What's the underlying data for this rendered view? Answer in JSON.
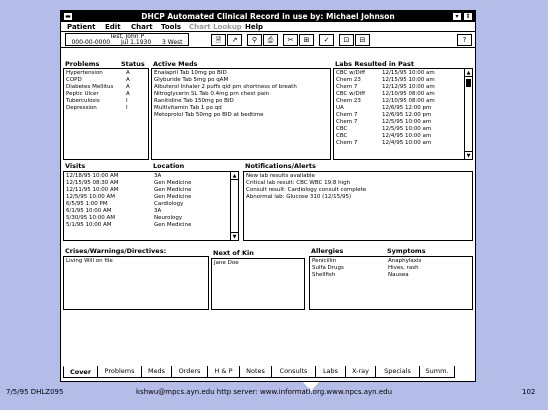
{
  "window": {
    "title": "DHCP Automated Clinical Record in use by: Michael Johnson",
    "control_icon": "▬",
    "minimize_icon": "▾",
    "restore_icon": "⇕"
  },
  "menu": [
    "Patient",
    "Edit",
    "Chart",
    "Tools",
    "Chart Lookup",
    "Help"
  ],
  "patient": {
    "name": "Test, John P",
    "ssn": "000-00-0000",
    "dob": "Jul 1,1930",
    "ward": "3 West"
  },
  "toolbar_icons": [
    "🗎",
    "↗",
    "⚲",
    "⎙",
    "✂",
    "⊞",
    "✓",
    "⊡",
    "⊟",
    "?"
  ],
  "problems": {
    "label": "Problems",
    "status_label": "Status",
    "rows": [
      [
        "Hypertension",
        "A"
      ],
      [
        "COPD",
        "A"
      ],
      [
        "Diabetes Mellitus",
        "A"
      ],
      [
        "Peptic Ulcer",
        "A"
      ],
      [
        "Tuberculosis",
        "I"
      ],
      [
        "Depression",
        "I"
      ]
    ]
  },
  "active_meds": {
    "label": "Active Meds",
    "rows": [
      "Enalapril Tab 10mg po BID",
      "Glyburide Tab 5mg po qAM",
      "Albuterol Inhaler 2 puffs qid prn shortness of breath",
      "Nitroglycerin SL Tab 0.4mg prn chest pain",
      "Ranitidine Tab 150mg po BID",
      "Multivitamin Tab 1 po qd",
      "Metoprolol Tab 50mg po BID at bedtime"
    ]
  },
  "labs": {
    "label": "Labs Resulted in Past",
    "rows": [
      [
        "CBC w/Diff",
        "12/15/95 10:00 am"
      ],
      [
        "Chem 23",
        "12/15/95 10:00 am"
      ],
      [
        "Chem 7",
        "12/12/95 10:00 am"
      ],
      [
        "CBC w/Diff",
        "12/10/95 08:00 am"
      ],
      [
        "Chem 23",
        "12/10/95 08:00 am"
      ],
      [
        "UA",
        "12/6/95 12:00 pm"
      ],
      [
        "Chem 7",
        "12/6/95 12:00 pm"
      ],
      [
        "Chem 7",
        "12/5/95 10:00 am"
      ],
      [
        "CBC",
        "12/5/95 10:00 am"
      ],
      [
        "CBC",
        "12/4/95 10:00 am"
      ],
      [
        "Chem 7",
        "12/4/95 10:00 am"
      ]
    ]
  },
  "visits": {
    "label": "Visits",
    "location_label": "Location",
    "rows": [
      [
        "12/18/95 10:00 AM",
        "3A"
      ],
      [
        "12/15/95 08:30 AM",
        "Gen Medicine"
      ],
      [
        "12/11/95 10:00 AM",
        "Gen Medicine"
      ],
      [
        "12/5/95 10:00 AM",
        "Gen Medicine"
      ],
      [
        "6/5/95 1:00 PM",
        "Cardiology"
      ],
      [
        "6/1/95 10:00 AM",
        "3A"
      ],
      [
        "5/30/95 10:00 AM",
        "Neurology"
      ],
      [
        "5/1/95 10:00 AM",
        "Gen Medicine"
      ]
    ]
  },
  "notifications": {
    "label": "Notifications/Alerts",
    "rows": [
      "New lab results available",
      "Critical lab result: CBC WBC 19.8 high",
      "Consult result: Cardiology consult complete",
      "Abnormal lab: Glucose 310 (12/15/95)"
    ]
  },
  "crises": {
    "label": "Crises/Warnings/Directives:",
    "rows": [
      "Living Will on file"
    ]
  },
  "next_of_kin": {
    "label": "Next of Kin",
    "rows": [
      "Jane Doe"
    ]
  },
  "allergies": {
    "label": "Allergies",
    "symptoms_label": "Symptoms",
    "rows": [
      [
        "Penicillin",
        "Anaphylaxis"
      ],
      [
        "Sulfa Drugs",
        "Hives, rash"
      ],
      [
        "Shellfish",
        "Nausea"
      ]
    ]
  },
  "tabs": [
    {
      "label": "Cover",
      "active": true
    },
    {
      "label": "Problems",
      "active": false
    },
    {
      "label": "Meds",
      "active": false
    },
    {
      "label": "Orders",
      "active": false
    },
    {
      "label": "H & P",
      "active": false
    },
    {
      "label": "Notes",
      "active": false
    },
    {
      "label": "Consults",
      "active": false
    },
    {
      "label": "Labs",
      "active": false
    },
    {
      "label": "X-ray",
      "active": false
    },
    {
      "label": "Specials",
      "active": false
    },
    {
      "label": "Summ.",
      "active": false
    }
  ],
  "footer": {
    "left": "7/5/95 DHLZ095",
    "center": "kshwu@mpcs.ayn.edu    http server: www.informatl.org.www.npcs.ayn.edu",
    "page": "102"
  }
}
